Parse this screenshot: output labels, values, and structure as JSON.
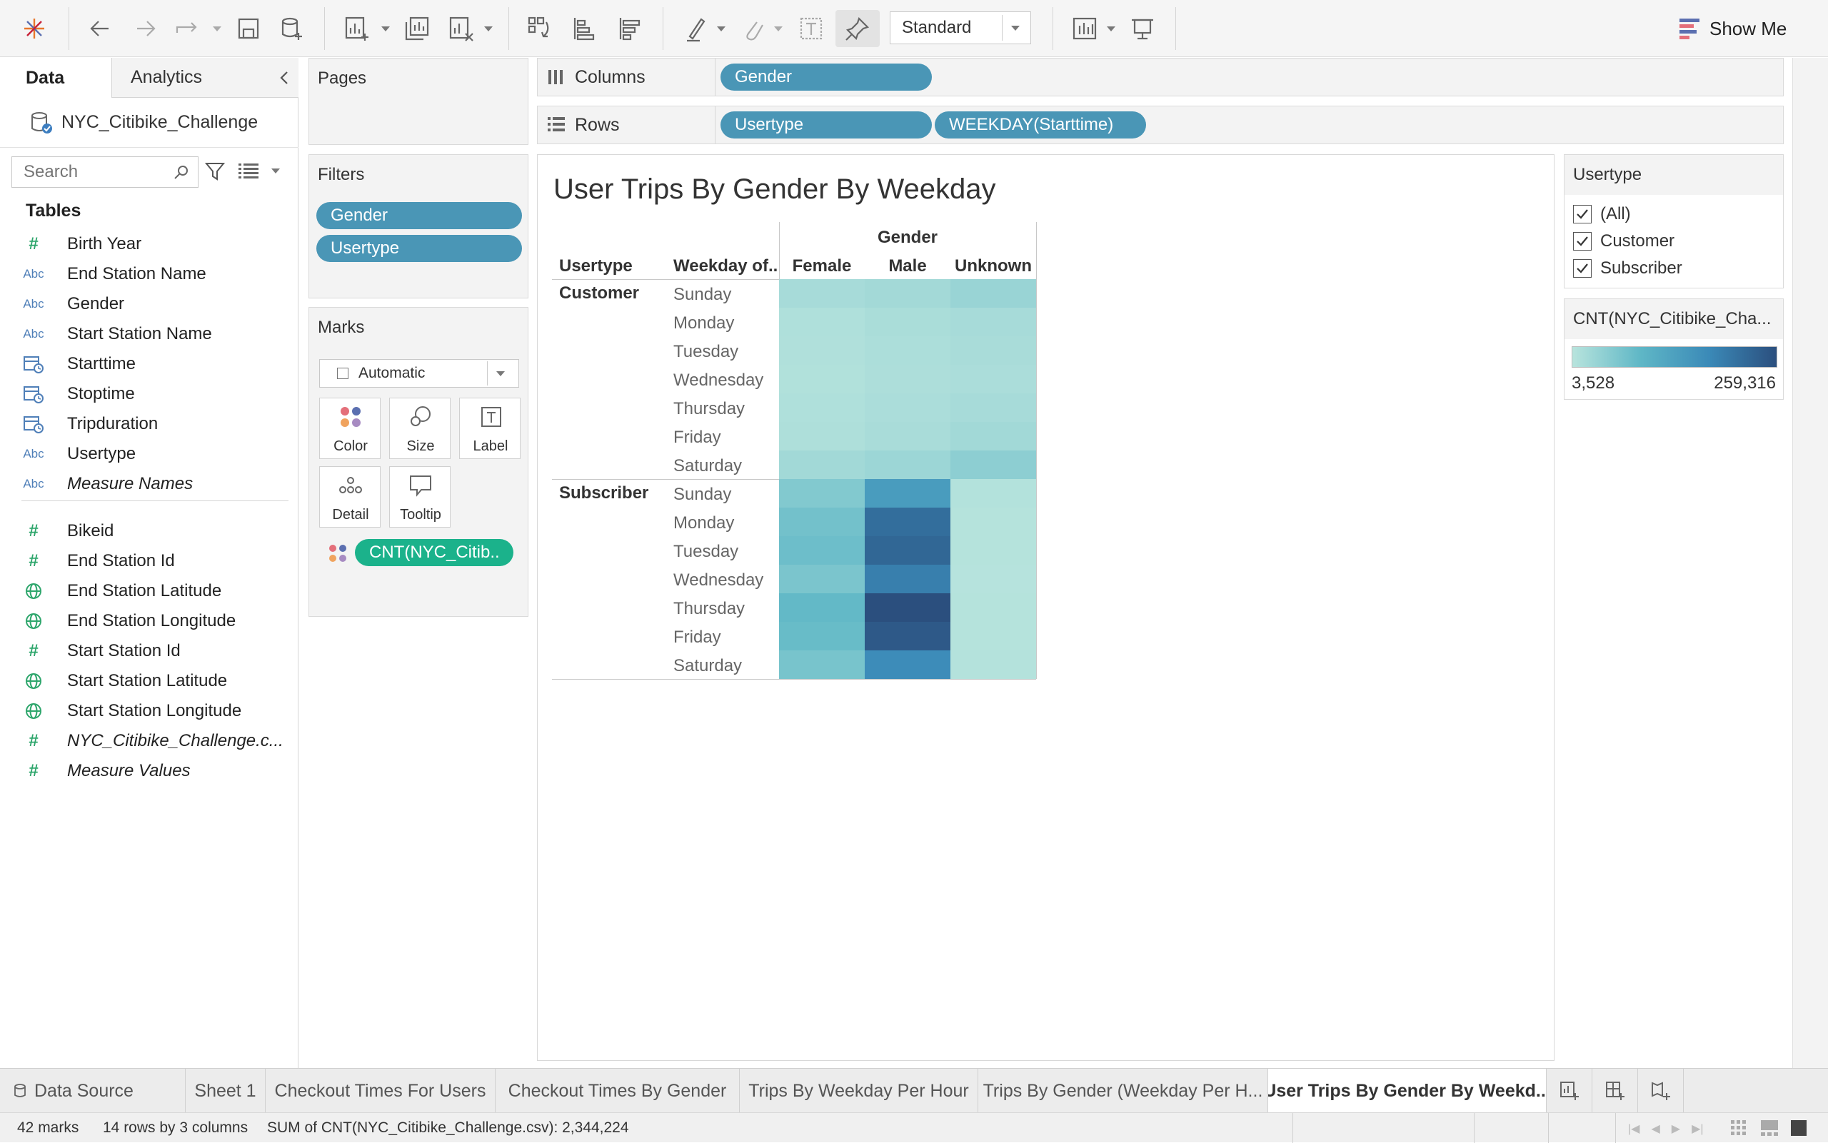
{
  "toolbar": {
    "fit_mode": "Standard",
    "show_me": "Show Me"
  },
  "data_pane": {
    "tab_data": "Data",
    "tab_analytics": "Analytics",
    "datasource": "NYC_Citibike_Challenge",
    "search_placeholder": "Search",
    "tables_heading": "Tables",
    "fields": [
      {
        "type": "#",
        "name": "Birth Year"
      },
      {
        "type": "Abc",
        "name": "End Station Name"
      },
      {
        "type": "Abc",
        "name": "Gender"
      },
      {
        "type": "Abc",
        "name": "Start Station Name"
      },
      {
        "type": "date",
        "name": "Starttime"
      },
      {
        "type": "date",
        "name": "Stoptime"
      },
      {
        "type": "date",
        "name": "Tripduration"
      },
      {
        "type": "Abc",
        "name": "Usertype"
      },
      {
        "type": "Abc",
        "name": "Measure Names"
      }
    ],
    "measures": [
      {
        "type": "#",
        "name": "Bikeid"
      },
      {
        "type": "#",
        "name": "End Station Id"
      },
      {
        "type": "geo",
        "name": "End Station Latitude"
      },
      {
        "type": "geo",
        "name": "End Station Longitude"
      },
      {
        "type": "#",
        "name": "Start Station Id"
      },
      {
        "type": "geo",
        "name": "Start Station Latitude"
      },
      {
        "type": "geo",
        "name": "Start Station Longitude"
      },
      {
        "type": "#",
        "name": "NYC_Citibike_Challenge.c..."
      },
      {
        "type": "#",
        "name": "Measure Values"
      }
    ]
  },
  "pages": {
    "title": "Pages"
  },
  "filters": {
    "title": "Filters",
    "pills": [
      "Gender",
      "Usertype"
    ]
  },
  "marks": {
    "title": "Marks",
    "mark_type": "Automatic",
    "buttons": [
      "Color",
      "Size",
      "Label",
      "Detail",
      "Tooltip"
    ],
    "measure_pill": "CNT(NYC_Citib.."
  },
  "shelves": {
    "columns_label": "Columns",
    "rows_label": "Rows",
    "columns_pills": [
      "Gender"
    ],
    "rows_pills": [
      "Usertype",
      "WEEKDAY(Starttime)"
    ]
  },
  "chart_data": {
    "type": "heatmap",
    "title": "User Trips By Gender By Weekday",
    "column_group_label": "Gender",
    "row_header_1": "Usertype",
    "row_header_2": "Weekday of..",
    "columns": [
      "Female",
      "Male",
      "Unknown"
    ],
    "row_groups": [
      {
        "name": "Customer",
        "rows": [
          "Sunday",
          "Monday",
          "Tuesday",
          "Wednesday",
          "Thursday",
          "Friday",
          "Saturday"
        ],
        "values": [
          [
            20000,
            24000,
            33000
          ],
          [
            12000,
            17000,
            20000
          ],
          [
            11000,
            15000,
            18000
          ],
          [
            10000,
            14000,
            16000
          ],
          [
            12000,
            16000,
            20000
          ],
          [
            13000,
            18000,
            25000
          ],
          [
            25000,
            30000,
            45000
          ]
        ]
      },
      {
        "name": "Subscriber",
        "rows": [
          "Sunday",
          "Monday",
          "Tuesday",
          "Wednesday",
          "Thursday",
          "Friday",
          "Saturday"
        ],
        "values": [
          [
            55000,
            140000,
            8000
          ],
          [
            70000,
            215000,
            6000
          ],
          [
            75000,
            225000,
            6000
          ],
          [
            62000,
            190000,
            5000
          ],
          [
            85000,
            259316,
            6000
          ],
          [
            80000,
            245000,
            6000
          ],
          [
            65000,
            170000,
            7000
          ]
        ]
      }
    ],
    "color_range": [
      3528,
      259316
    ]
  },
  "usertype_filter": {
    "title": "Usertype",
    "options": [
      {
        "label": "(All)",
        "checked": true
      },
      {
        "label": "Customer",
        "checked": true
      },
      {
        "label": "Subscriber",
        "checked": true
      }
    ]
  },
  "legend": {
    "title": "CNT(NYC_Citibike_Cha...",
    "min_label": "3,528",
    "max_label": "259,316",
    "color_low": "#b8e4dd",
    "color_high": "#2b4f7e"
  },
  "tabs": [
    {
      "label": "Data Source",
      "active": false
    },
    {
      "label": "Sheet 1",
      "active": false
    },
    {
      "label": "Checkout Times For Users",
      "active": false
    },
    {
      "label": "Checkout Times By Gender",
      "active": false
    },
    {
      "label": "Trips By Weekday Per Hour",
      "active": false
    },
    {
      "label": "Trips By Gender (Weekday Per H...",
      "active": false
    },
    {
      "label": "User Trips By Gender By Weekd...",
      "active": true
    }
  ],
  "status": {
    "marks": "42 marks",
    "dims": "14 rows by 3 columns",
    "sum": "SUM of CNT(NYC_Citibike_Challenge.csv): 2,344,224"
  }
}
